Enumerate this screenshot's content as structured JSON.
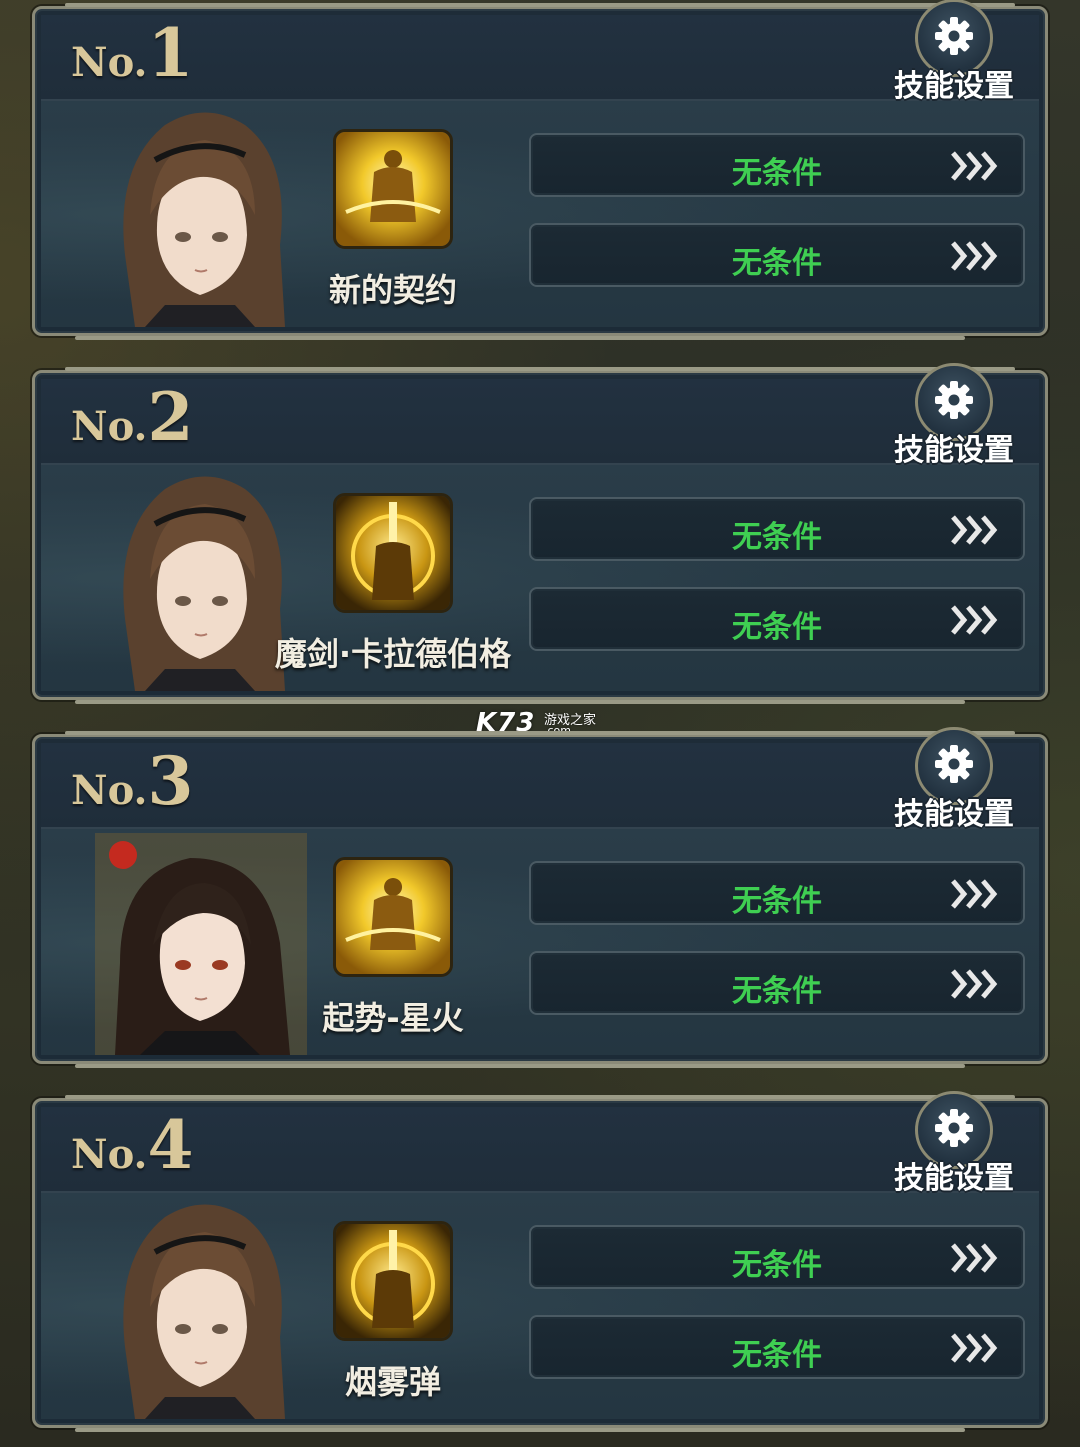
{
  "colors": {
    "rank_gold": "#d8c79a",
    "condition_green": "#3fcf52",
    "panel_bg": "#1e2c38",
    "frame": "#8a8a78"
  },
  "skill_setting_label": "技能设置",
  "rank_prefix": "No.",
  "slots": [
    {
      "rank": "1",
      "skill_name": "新的契约",
      "skill_icon": "golden-armored-warrior-icon",
      "portrait": "brown-haired-girl-portrait",
      "conditions": [
        "无条件",
        "无条件"
      ]
    },
    {
      "rank": "2",
      "skill_name": "魔剑·卡拉德伯格",
      "skill_icon": "golden-sword-summon-icon",
      "portrait": "brown-haired-girl-portrait",
      "conditions": [
        "无条件",
        "无条件"
      ]
    },
    {
      "rank": "3",
      "skill_name": "起势-星火",
      "skill_icon": "golden-armored-warrior-icon",
      "portrait": "black-haired-girl-portrait",
      "conditions": [
        "无条件",
        "无条件"
      ]
    },
    {
      "rank": "4",
      "skill_name": "烟雾弹",
      "skill_icon": "golden-sword-summon-icon",
      "portrait": "brown-haired-girl-portrait",
      "conditions": [
        "无条件",
        "无条件"
      ]
    }
  ],
  "watermark": {
    "logo": "K73",
    "text": "游戏之家",
    "domain": ".com"
  }
}
